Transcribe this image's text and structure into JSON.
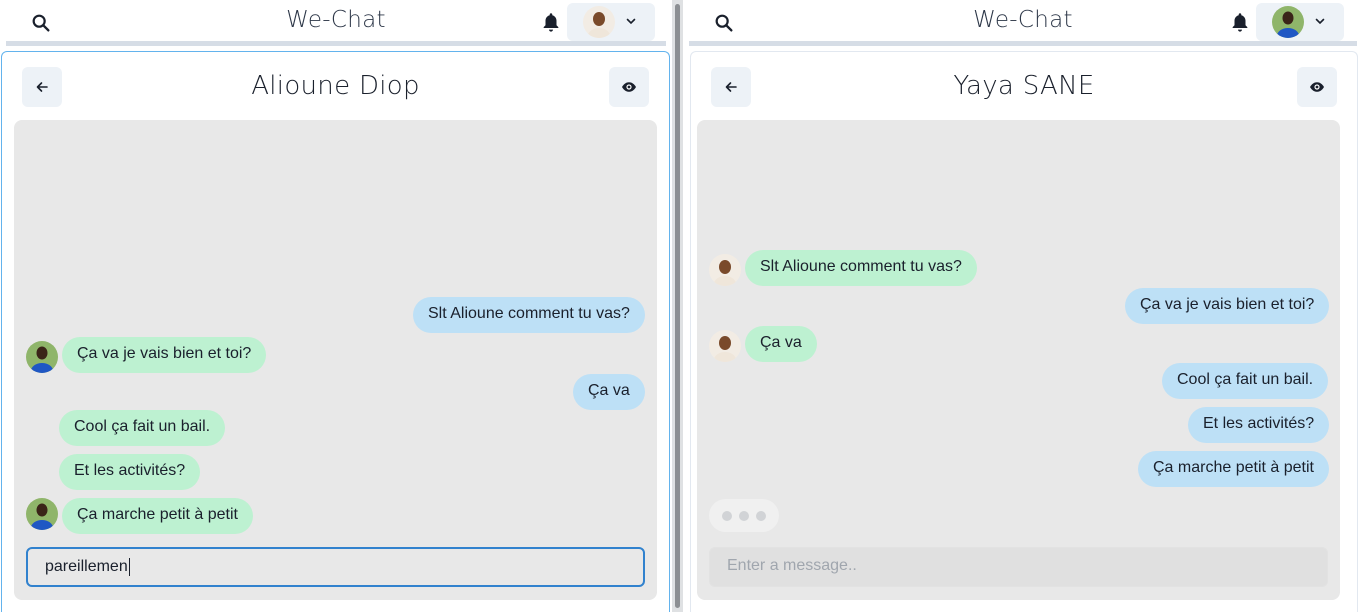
{
  "left": {
    "app_title": "We-Chat",
    "chat_title": "Alioune Diop",
    "messages": [
      {
        "side": "out",
        "text": "Slt Alioune comment tu vas?"
      },
      {
        "side": "in",
        "text": "Ça va je vais bien et toi?"
      },
      {
        "side": "out",
        "text": "Ça va"
      },
      {
        "side": "in",
        "text": "Cool ça fait un bail."
      },
      {
        "side": "in",
        "text": "Et les activités?"
      },
      {
        "side": "in",
        "text": "Ça marche petit à petit"
      }
    ],
    "input_value": "pareillemen"
  },
  "right": {
    "app_title": "We-Chat",
    "chat_title": "Yaya SANE",
    "messages": [
      {
        "side": "in",
        "text": "Slt Alioune comment tu vas?"
      },
      {
        "side": "out",
        "text": "Ça va je vais bien et toi?"
      },
      {
        "side": "in",
        "text": "Ça va"
      },
      {
        "side": "out",
        "text": "Cool ça fait un bail."
      },
      {
        "side": "out",
        "text": "Et les activités?"
      },
      {
        "side": "out",
        "text": "Ça marche petit à petit"
      }
    ],
    "input_placeholder": "Enter a message.."
  },
  "icons": {
    "search": "search-icon",
    "bell": "bell-icon",
    "chevron": "chevron-down-icon",
    "back": "arrow-left-icon",
    "eye": "eye-icon"
  },
  "colors": {
    "incoming_bubble": "#bdf1d1",
    "outgoing_bubble": "#bde0f6",
    "focus_border": "#3182ce",
    "chat_background": "#e8e8e8"
  }
}
